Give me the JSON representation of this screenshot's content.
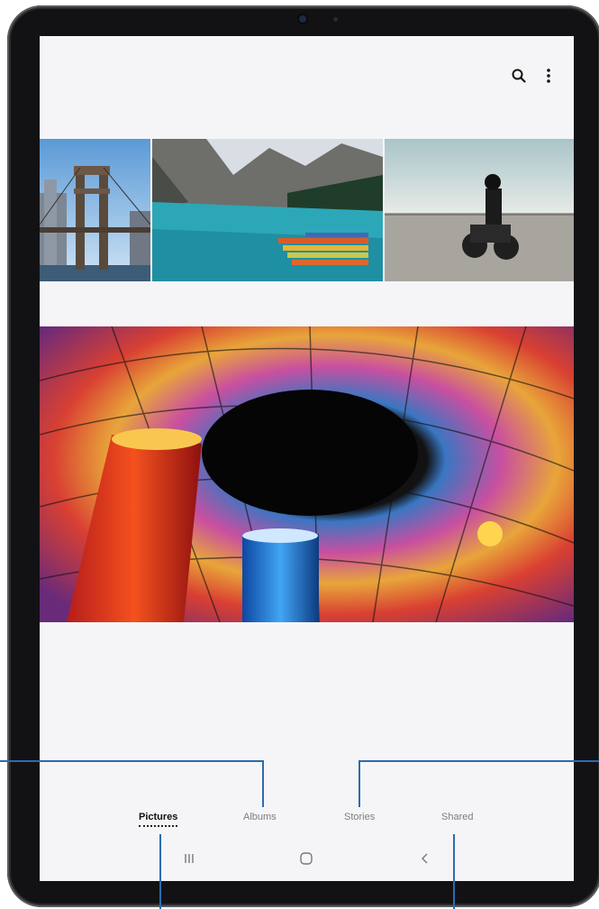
{
  "tabs": [
    {
      "label": "Pictures",
      "active": true
    },
    {
      "label": "Albums",
      "active": false
    },
    {
      "label": "Stories",
      "active": false
    },
    {
      "label": "Shared",
      "active": false
    }
  ],
  "toolbar": {
    "search_icon": "search-icon",
    "more_icon": "more-options-icon"
  },
  "navigation": {
    "recents_icon": "recents-icon",
    "home_icon": "home-icon",
    "back_icon": "back-icon"
  },
  "colors": {
    "callout_line": "#2b6cb0",
    "screen_background": "#f5f5f7",
    "device_frame": "#2c2c2e"
  },
  "photos": [
    {
      "subject": "bridge"
    },
    {
      "subject": "mountain lake with canoes"
    },
    {
      "subject": "motorcycle rider on dry lake bed"
    },
    {
      "subject": "stained glass dome"
    }
  ]
}
